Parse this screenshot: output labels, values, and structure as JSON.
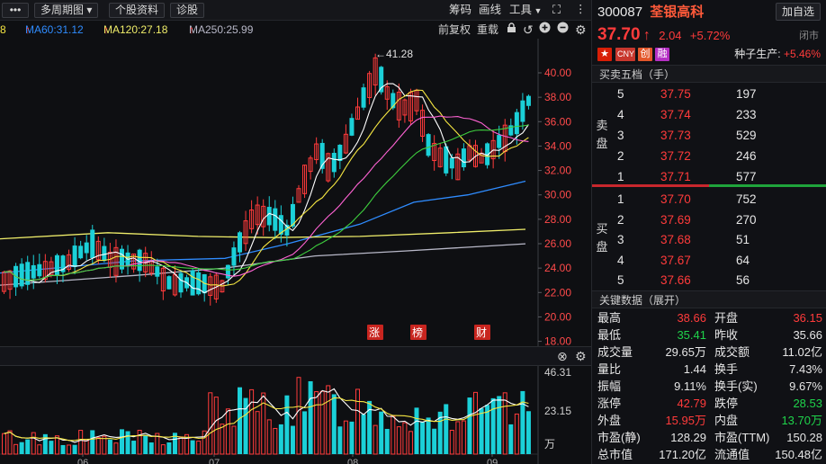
{
  "toolbar": {
    "menu_label": "•••",
    "period_label": "多周期图",
    "profile_label": "个股资料",
    "diagnose_label": "诊股",
    "chips_label": "筹码",
    "draw_label": "画线",
    "tools_label": "工具"
  },
  "ma_legend": {
    "ma_partial": "8",
    "ma60": "MA60:31.12",
    "ma120": "MA120:27.18",
    "ma250": "MA250:25.99",
    "arrow": "↑"
  },
  "chart_tools": {
    "adjust_label": "前复权",
    "overlay_label": "重载"
  },
  "stock": {
    "code": "300087",
    "name": "荃银高科",
    "price": "37.70",
    "arrow": "↑",
    "change": "2.04",
    "change_pct": "+5.72%",
    "status": "闭市",
    "add_fav": "加自选",
    "tags": [
      "CNY",
      "创",
      "融"
    ],
    "sector_name": "种子生产",
    "sector_pct": "+5.46%"
  },
  "order_book": {
    "title": "买卖五档（手）",
    "sell_label": "卖盘",
    "buy_label": "买盘",
    "sells": [
      {
        "level": "5",
        "price": "37.75",
        "volume": "197"
      },
      {
        "level": "4",
        "price": "37.74",
        "volume": "233"
      },
      {
        "level": "3",
        "price": "37.73",
        "volume": "529"
      },
      {
        "level": "2",
        "price": "37.72",
        "volume": "246"
      },
      {
        "level": "1",
        "price": "37.71",
        "volume": "577"
      }
    ],
    "buys": [
      {
        "level": "1",
        "price": "37.70",
        "volume": "752"
      },
      {
        "level": "2",
        "price": "37.69",
        "volume": "270"
      },
      {
        "level": "3",
        "price": "37.68",
        "volume": "51"
      },
      {
        "level": "4",
        "price": "37.67",
        "volume": "64"
      },
      {
        "level": "5",
        "price": "37.66",
        "volume": "56"
      }
    ]
  },
  "key_data": {
    "title": "关键数据（展开）",
    "rows": [
      {
        "l1": "最高",
        "v1": "38.66",
        "c1": "red",
        "l2": "开盘",
        "v2": "36.15",
        "c2": "red"
      },
      {
        "l1": "最低",
        "v1": "35.41",
        "c1": "green",
        "l2": "昨收",
        "v2": "35.66",
        "c2": "white"
      },
      {
        "l1": "成交量",
        "v1": "29.65万",
        "c1": "white",
        "l2": "成交额",
        "v2": "11.02亿",
        "c2": "white"
      },
      {
        "l1": "量比",
        "v1": "1.44",
        "c1": "white",
        "l2": "换手",
        "v2": "7.43%",
        "c2": "white"
      },
      {
        "l1": "振幅",
        "v1": "9.11%",
        "c1": "white",
        "l2": "换手(实)",
        "v2": "9.67%",
        "c2": "white"
      },
      {
        "l1": "涨停",
        "v1": "42.79",
        "c1": "red",
        "l2": "跌停",
        "v2": "28.53",
        "c2": "green"
      },
      {
        "l1": "外盘",
        "v1": "15.95万",
        "c1": "red",
        "l2": "内盘",
        "v2": "13.70万",
        "c2": "green"
      },
      {
        "l1": "市盈(静)",
        "v1": "128.29",
        "c1": "white",
        "l2": "市盈(TTM)",
        "v2": "150.28",
        "c2": "white"
      },
      {
        "l1": "总市值",
        "v1": "171.20亿",
        "c1": "white",
        "l2": "流通值",
        "v2": "150.48亿",
        "c2": "white"
      }
    ]
  },
  "colors": {
    "up": "#ff3b3b",
    "down": "#1bd0d8",
    "ma5": "#ffffff",
    "ma10": "#f5e642",
    "ma20": "#ff63d4",
    "ma30": "#3ecf3e",
    "ma60": "#2f8cff",
    "ma120": "#f0ee6a",
    "ma250": "#b8b8c8"
  },
  "chart_data": {
    "type": "candlestick",
    "y_ticks": [
      "40.00",
      "38.00",
      "36.00",
      "34.00",
      "32.00",
      "30.00",
      "28.00",
      "26.00",
      "24.00",
      "22.00",
      "20.00",
      "18.00"
    ],
    "ylim": [
      17.6,
      42.8
    ],
    "peak_label": "41.28",
    "event_markers": [
      "涨",
      "榜",
      "财"
    ],
    "x_ticks": [
      "06",
      "07",
      "08",
      "09"
    ],
    "volume_ticks": [
      "46.31",
      "23.15",
      "万"
    ],
    "ma60_points": [
      [
        0,
        23.6
      ],
      [
        150,
        24.6
      ],
      [
        250,
        24.8
      ],
      [
        320,
        26.0
      ],
      [
        400,
        27.6
      ],
      [
        460,
        29.4
      ],
      [
        520,
        30.0
      ],
      [
        584,
        31.12
      ]
    ],
    "ma120_points": [
      [
        0,
        26.4
      ],
      [
        120,
        26.9
      ],
      [
        220,
        26.6
      ],
      [
        300,
        26.5
      ],
      [
        400,
        26.6
      ],
      [
        500,
        26.9
      ],
      [
        584,
        27.18
      ]
    ],
    "ma250_points": [
      [
        0,
        22.6
      ],
      [
        150,
        23.4
      ],
      [
        250,
        24.0
      ],
      [
        350,
        25.0
      ],
      [
        450,
        25.4
      ],
      [
        584,
        25.99
      ]
    ]
  }
}
